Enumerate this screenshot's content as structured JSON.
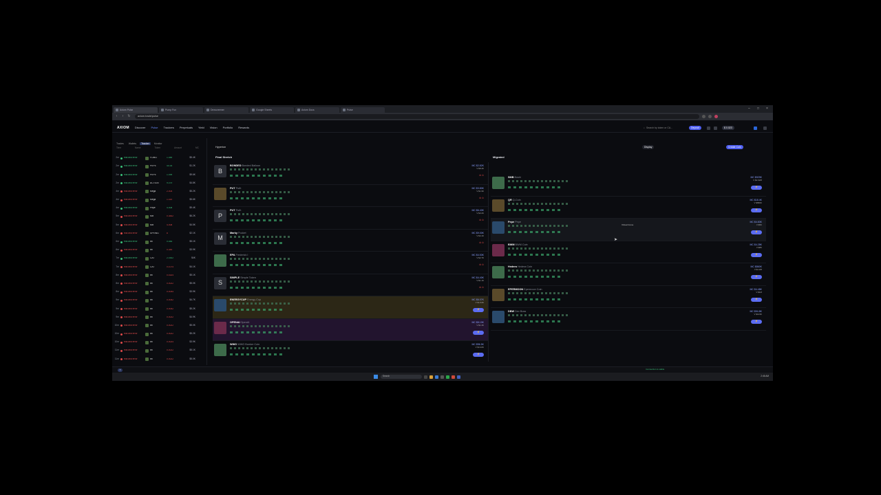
{
  "browser": {
    "tabs": [
      "Axiom Pulse",
      "Pump Fun",
      "Dexscreener",
      "Google Sheets",
      "Axiom Docs",
      "Pulse"
    ],
    "url": "axiom.trade/pulse"
  },
  "app": {
    "logo": "AXIOM",
    "nav": [
      "Discover",
      "Pulse",
      "Trackers",
      "Perpetuals",
      "Yield",
      "Vision",
      "Portfolio",
      "Rewards"
    ],
    "search_placeholder": "Search by token or CA...",
    "deposit_label": "Deposit",
    "balance": "$ 0.023",
    "display_label": "Display",
    "create_label": "Create Coin",
    "tracker_title": "Hyperion"
  },
  "sidebar": {
    "tabs": [
      "Trades",
      "Wallets",
      "Tracker",
      "Monitor"
    ],
    "headers": [
      "Time",
      "Name",
      "Token",
      "Amount",
      "MC"
    ],
    "rows": [
      {
        "n": "2m",
        "name": "trial and error",
        "tk": "FOMO",
        "amt": "1.089",
        "mc": "$5.4K",
        "c": "#3ac27a"
      },
      {
        "n": "2m",
        "name": "trial and error",
        "tk": "PEPE",
        "amt": "40.34",
        "mc": "$1.2K",
        "c": "#3ac27a"
      },
      {
        "n": "2m",
        "name": "trial and error",
        "tk": "PEPE",
        "amt": "1.099",
        "mc": "$9.6K",
        "c": "#3ac27a"
      },
      {
        "n": "2m",
        "name": "trial and error",
        "tk": "ACTION",
        "amt": "9.079",
        "mc": "$4.8K",
        "c": "#3ac27a"
      },
      {
        "n": "4m",
        "name": "trial and error",
        "tk": "Mega",
        "amt": "2.004",
        "mc": "$5.2K",
        "c": "#e04a4a"
      },
      {
        "n": "4m",
        "name": "trial and error",
        "tk": "Mega",
        "amt": "1.020",
        "mc": "$5.6K",
        "c": "#e04a4a"
      },
      {
        "n": "4m",
        "name": "trial and error",
        "tk": "Pepe",
        "amt": "4.008",
        "mc": "$9.4K",
        "c": "#3ac27a"
      },
      {
        "n": "5m",
        "name": "trial and error",
        "tk": "Mix",
        "amt": "0.3832",
        "mc": "$6.2K",
        "c": "#e04a4a"
      },
      {
        "n": "5m",
        "name": "trial and error",
        "tk": "Mix",
        "amt": "4.008",
        "mc": "$4.5K",
        "c": "#e04a4a"
      },
      {
        "n": "6m",
        "name": "trial and error",
        "tk": "SPRING",
        "amt": "8",
        "mc": "$2.1K",
        "c": "#e04a4a"
      },
      {
        "n": "6m",
        "name": "trial and error",
        "tk": "bit",
        "amt": "0.084",
        "mc": "$5.1K",
        "c": "#3ac27a"
      },
      {
        "n": "6m",
        "name": "trial and error",
        "tk": "bit",
        "amt": "0.344",
        "mc": "$3.9K",
        "c": "#e04a4a"
      },
      {
        "n": "7m",
        "name": "trial and error",
        "tk": "CAT",
        "amt": "2.0302",
        "mc": "$4K",
        "c": "#3ac27a"
      },
      {
        "n": "7m",
        "name": "trial and error",
        "tk": "CAT",
        "amt": "0.1074",
        "mc": "$4.1K",
        "c": "#e04a4a"
      },
      {
        "n": "8m",
        "name": "trial and error",
        "tk": "bit",
        "amt": "0.4324",
        "mc": "$5.1K",
        "c": "#e04a4a"
      },
      {
        "n": "8m",
        "name": "trial and error",
        "tk": "bit",
        "amt": "0.0022",
        "mc": "$5.0K",
        "c": "#e04a4a"
      },
      {
        "n": "8m",
        "name": "trial and error",
        "tk": "bit",
        "amt": "0.0044",
        "mc": "$3.9K",
        "c": "#e04a4a"
      },
      {
        "n": "9m",
        "name": "trial and error",
        "tk": "bit",
        "amt": "0.0042",
        "mc": "$4.7K",
        "c": "#e04a4a"
      },
      {
        "n": "9m",
        "name": "trial and error",
        "tk": "bit",
        "amt": "0.0042",
        "mc": "$5.2K",
        "c": "#e04a4a"
      },
      {
        "n": "9m",
        "name": "trial and error",
        "tk": "bit",
        "amt": "0.0022",
        "mc": "$4.9K",
        "c": "#e04a4a"
      },
      {
        "n": "10m",
        "name": "trial and error",
        "tk": "bit",
        "amt": "0.0022",
        "mc": "$5.0K",
        "c": "#e04a4a"
      },
      {
        "n": "10m",
        "name": "trial and error",
        "tk": "bit",
        "amt": "0.0022",
        "mc": "$5.2K",
        "c": "#e04a4a"
      },
      {
        "n": "10m",
        "name": "trial and error",
        "tk": "bit",
        "amt": "0.0024",
        "mc": "$3.9K",
        "c": "#e04a4a"
      },
      {
        "n": "11m",
        "name": "trial and error",
        "tk": "bit",
        "amt": "0.0022",
        "mc": "$5.1K",
        "c": "#e04a4a"
      },
      {
        "n": "11m",
        "name": "trial and error",
        "tk": "bit",
        "amt": "0.0022",
        "mc": "$5.0K",
        "c": "#e04a4a"
      }
    ]
  },
  "final_stretch": {
    "title": "Final Stretch",
    "cards": [
      {
        "img": "B",
        "tkr": "BONDED",
        "full": "Bonded Balloon",
        "mcap": "MC $2.82K",
        "vol": "V $8.4K",
        "style": "",
        "right": "red"
      },
      {
        "img": "",
        "tkr": "PUT",
        "full": "PutIt",
        "mcap": "MC $3.80K",
        "vol": "V $1.9K",
        "style": "",
        "right": "red"
      },
      {
        "img": "P",
        "tkr": "PUT",
        "full": "PutIt",
        "mcap": "MC $6.40K",
        "vol": "V $3.2K",
        "style": "",
        "right": "red"
      },
      {
        "img": "M",
        "tkr": "Marky",
        "full": "Pocket",
        "mcap": "MC $9.00K",
        "vol": "V $4.1K",
        "style": "",
        "right": "red"
      },
      {
        "img": "",
        "tkr": "EPA",
        "full": "Frederick I",
        "mcap": "MC $4.53K",
        "vol": "V $2.7K",
        "style": "",
        "right": "red"
      },
      {
        "img": "S",
        "tkr": "SIMPLE",
        "full": "Simple Token",
        "mcap": "MC $4.40K",
        "vol": "V $1.1K",
        "style": "",
        "right": "red"
      },
      {
        "img": "",
        "tkr": "ENERGYCUP",
        "full": "Energy Cup",
        "mcap": "MC $6.07K",
        "vol": "V $1.64K",
        "style": "gold",
        "right": "buy"
      },
      {
        "img": "",
        "tkr": "OPENAI",
        "full": "OpenAI",
        "mcap": "MC $8.19K",
        "vol": "V $1.4K",
        "style": "purple",
        "right": "buy"
      },
      {
        "img": "",
        "tkr": "WWG",
        "full": "WWG Bunker Coin",
        "mcap": "MC $56.5K",
        "vol": "V $3.22K",
        "style": "",
        "right": "buy"
      }
    ]
  },
  "migrated": {
    "title": "Migrated",
    "cursor_tooltip": "Virtual Curve",
    "cards": [
      {
        "img": "",
        "tkr": "SMB",
        "full": "Boshi",
        "mcap": "MC $929K",
        "vol": "V $2.62M",
        "style": "",
        "right": "buy"
      },
      {
        "img": "",
        "tkr": "QR",
        "full": "Q-Coin",
        "mcap": "MC $18.4K",
        "vol": "V $580K",
        "style": "",
        "right": "buy"
      },
      {
        "img": "",
        "tkr": "Pepe",
        "full": "Pepe",
        "mcap": "MC $4.83K",
        "vol": "V $5K",
        "style": "hl",
        "right": "buy"
      },
      {
        "img": "",
        "tkr": "BWM",
        "full": "BWM Coin",
        "mcap": "MC $4.28K",
        "vol": "V $8K",
        "style": "",
        "right": "buy"
      },
      {
        "img": "",
        "tkr": "Hedera",
        "full": "Hedera Coin",
        "mcap": "MC $860K",
        "vol": "V $1.2M",
        "style": "",
        "right": "buy"
      },
      {
        "img": "",
        "tkr": "EPERMOON",
        "full": "Epermoon Coin",
        "mcap": "MC $4.48K",
        "vol": "V $1M",
        "style": "",
        "right": "buy"
      },
      {
        "img": "",
        "tkr": "DBW",
        "full": "Dev Boss",
        "mcap": "MC $94.8K",
        "vol": "V $123K",
        "style": "",
        "right": "buy"
      }
    ]
  },
  "bottom": {
    "status": "Connection is stable",
    "search_label": "Search",
    "time": "2:46 AM"
  },
  "colors": {
    "accent": "#5b6cf2",
    "up": "#3ac27a",
    "down": "#e04a4a",
    "bg": "#0b0c10"
  }
}
